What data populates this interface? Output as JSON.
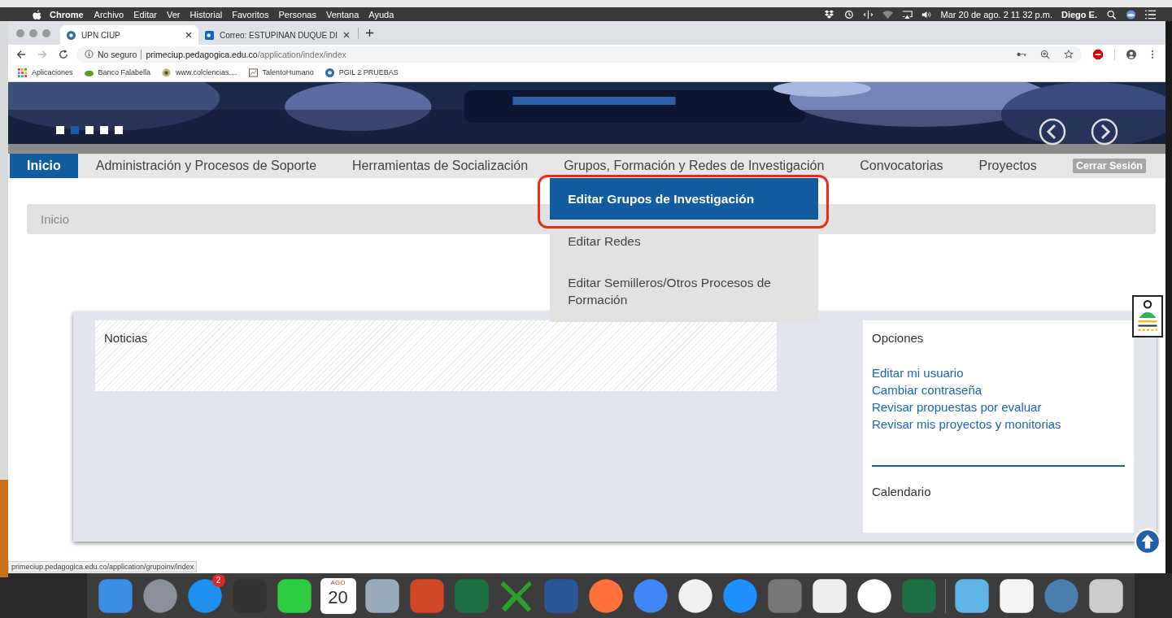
{
  "menubar": {
    "app": "Chrome",
    "menus": [
      "Archivo",
      "Editar",
      "Ver",
      "Historial",
      "Favoritos",
      "Personas",
      "Ventana",
      "Ayuda"
    ],
    "clock": "Mar 20 de ago.  2 11 32 p.m.",
    "user": "Diego E."
  },
  "tabs": [
    {
      "title": "UPN CIUP",
      "selected": true
    },
    {
      "title": "Correo: ESTUPINAN DUQUE DI",
      "selected": false
    }
  ],
  "address_bar": {
    "security": "No seguro",
    "host": "primeciup.pedagogica.edu.co",
    "path": "/application/index/index"
  },
  "bookmarks": [
    "Aplicaciones",
    "Banco Falabella",
    "www.colciencias....",
    "TalentoHumano",
    "PGIL 2 PRUEBAS"
  ],
  "banner": {
    "slides": [
      {
        "selected": false
      },
      {
        "selected": true
      },
      {
        "selected": false
      },
      {
        "selected": false
      },
      {
        "selected": false
      }
    ]
  },
  "nav": {
    "items": [
      {
        "label": "Inicio",
        "selected": true
      },
      {
        "label": "Administración y Procesos de Soporte",
        "selected": false
      },
      {
        "label": "Herramientas de Socialización",
        "selected": false
      },
      {
        "label": "Grupos, Formación y Redes de Investigación",
        "selected": false
      },
      {
        "label": "Convocatorias",
        "selected": false
      },
      {
        "label": "Proyectos",
        "selected": false
      }
    ],
    "logout": "Cerrar Sesión",
    "dropdown": [
      {
        "label": "Editar Grupos de Investigación",
        "selected": true
      },
      {
        "label": "Editar Redes",
        "selected": false
      },
      {
        "label": "Editar Semilleros/Otros Procesos de Formación",
        "selected": false
      }
    ]
  },
  "breadcrumb": "Inicio",
  "news": {
    "title": "Noticias"
  },
  "options": {
    "title": "Opciones",
    "links": [
      "Editar mi usuario",
      "Cambiar contraseña",
      "Revisar propuestas por evaluar",
      "Revisar mis proyectos y monitorias"
    ],
    "calendar_title": "Calendario"
  },
  "status_url": "primeciup.pedagogica.edu.co/application/grupoinv/index",
  "dock": {
    "badge": "2",
    "calendar_month": "AGO",
    "calendar_day": "20"
  }
}
